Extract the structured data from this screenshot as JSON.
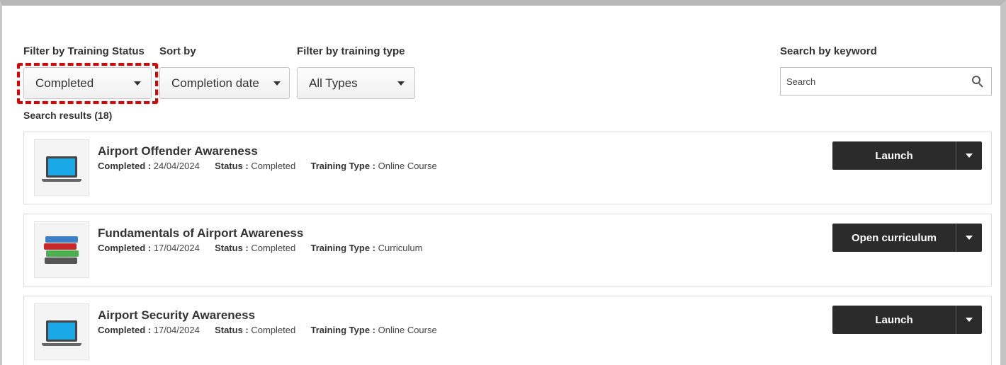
{
  "filters": {
    "training_status": {
      "label": "Filter by Training Status",
      "value": "Completed"
    },
    "sort": {
      "label": "Sort by",
      "value": "Completion date"
    },
    "training_type": {
      "label": "Filter by training type",
      "value": "All Types"
    },
    "search": {
      "label": "Search by keyword",
      "placeholder": "Search"
    }
  },
  "results": {
    "count_text": "Search results (18)",
    "items": [
      {
        "title": "Airport Offender Awareness",
        "completed_label": "Completed :",
        "completed": "24/04/2024",
        "status_label": "Status :",
        "status": "Completed",
        "type_label": "Training Type :",
        "type": "Online Course",
        "icon": "laptop-icon",
        "action": "Launch"
      },
      {
        "title": "Fundamentals of Airport Awareness",
        "completed_label": "Completed :",
        "completed": "17/04/2024",
        "status_label": "Status :",
        "status": "Completed",
        "type_label": "Training Type :",
        "type": "Curriculum",
        "icon": "books-icon",
        "action": "Open curriculum"
      },
      {
        "title": "Airport Security Awareness",
        "completed_label": "Completed :",
        "completed": "17/04/2024",
        "status_label": "Status :",
        "status": "Completed",
        "type_label": "Training Type :",
        "type": "Online Course",
        "icon": "laptop-icon",
        "action": "Launch"
      }
    ]
  },
  "colors": {
    "highlight": "#e00000",
    "button": "#2b2b2b",
    "laptop_screen": "#1aa9e6"
  }
}
